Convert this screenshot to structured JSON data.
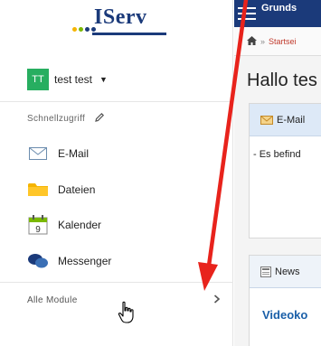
{
  "brand": {
    "logo_text": "IServ",
    "dot_colors": [
      "#f5b400",
      "#7ab800",
      "#1b3a7a",
      "#1b3a7a"
    ]
  },
  "user": {
    "initials": "TT",
    "name": "test test"
  },
  "sidebar": {
    "quick_access_label": "Schnellzugriff",
    "items": [
      {
        "label": "E-Mail",
        "icon": "envelope-icon"
      },
      {
        "label": "Dateien",
        "icon": "folder-icon"
      },
      {
        "label": "Kalender",
        "icon": "calendar-icon",
        "calendar_day": "9"
      },
      {
        "label": "Messenger",
        "icon": "chat-bubbles-icon"
      }
    ],
    "all_modules_label": "Alle Module"
  },
  "main": {
    "topbar_title": "Grunds",
    "breadcrumb": {
      "separator": "»",
      "current": "Startsei"
    },
    "greeting": "Hallo tes",
    "email_panel": {
      "title": "E-Mail",
      "text": "- Es befind"
    },
    "news_panel": {
      "title": "News",
      "link": "Videoko"
    }
  },
  "colors": {
    "brand_blue": "#1b3a7a",
    "avatar_green": "#27ae60",
    "panel_header": "#dde9f7",
    "annotation_arrow": "#e8231c",
    "link_blue": "#1a5fa8"
  }
}
